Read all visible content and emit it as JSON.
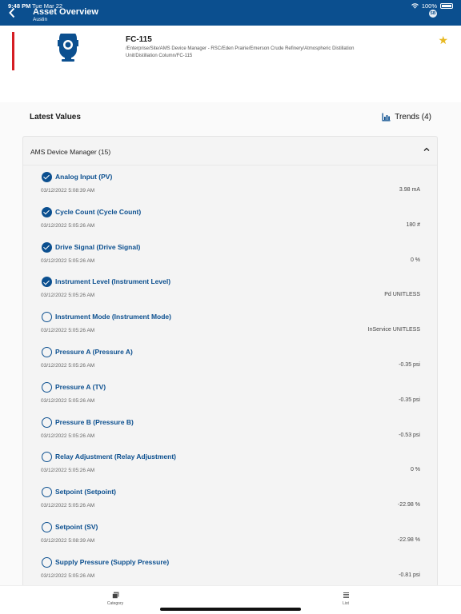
{
  "status_bar": {
    "time": "9:48 PM",
    "date": "Tue Mar 22",
    "battery": "100%"
  },
  "header": {
    "title": "Asset Overview",
    "subtitle": "Austin",
    "avatar_initials": "SB"
  },
  "device": {
    "name": "FC-115",
    "path": "/Enterprise/Site/AMS Device Manager - RSC/Eden Prairie/Emerson Crude Refinery/Atmospheric Distillation Unit/Distillation Column/FC-115"
  },
  "latest": {
    "title": "Latest Values",
    "trends_label": "Trends (4)"
  },
  "card": {
    "title": "AMS Device Manager (15)"
  },
  "items": [
    {
      "label": "Analog Input (PV)",
      "date": "03/12/2022 5:08:39 AM",
      "value": "3.98 mA",
      "checked": true
    },
    {
      "label": "Cycle Count (Cycle Count)",
      "date": "03/12/2022 5:05:26 AM",
      "value": "180 #",
      "checked": true
    },
    {
      "label": "Drive Signal (Drive Signal)",
      "date": "03/12/2022 5:05:26 AM",
      "value": "0 %",
      "checked": true
    },
    {
      "label": "Instrument Level (Instrument Level)",
      "date": "03/12/2022 5:05:26 AM",
      "value": "Pd UNITLESS",
      "checked": true
    },
    {
      "label": "Instrument Mode (Instrument Mode)",
      "date": "03/12/2022 5:05:26 AM",
      "value": "InService UNITLESS",
      "checked": false
    },
    {
      "label": "Pressure A (Pressure A)",
      "date": "03/12/2022 5:05:26 AM",
      "value": "-0.35 psi",
      "checked": false
    },
    {
      "label": "Pressure A (TV)",
      "date": "03/12/2022 5:05:26 AM",
      "value": "-0.35 psi",
      "checked": false
    },
    {
      "label": "Pressure B (Pressure B)",
      "date": "03/12/2022 5:05:26 AM",
      "value": "-0.53 psi",
      "checked": false
    },
    {
      "label": "Relay Adjustment (Relay Adjustment)",
      "date": "03/12/2022 5:05:26 AM",
      "value": "0 %",
      "checked": false
    },
    {
      "label": "Setpoint (Setpoint)",
      "date": "03/12/2022 5:05:26 AM",
      "value": "-22.98 %",
      "checked": false
    },
    {
      "label": "Setpoint (SV)",
      "date": "03/12/2022 5:08:39 AM",
      "value": "-22.98 %",
      "checked": false
    },
    {
      "label": "Supply Pressure (Supply Pressure)",
      "date": "03/12/2022 5:05:26 AM",
      "value": "-0.81 psi",
      "checked": false
    }
  ],
  "bottom_nav": {
    "category": "Category",
    "list": "List"
  },
  "colors": {
    "primary": "#0b4f8f",
    "alert": "#d51d23",
    "star": "#e8b923"
  }
}
